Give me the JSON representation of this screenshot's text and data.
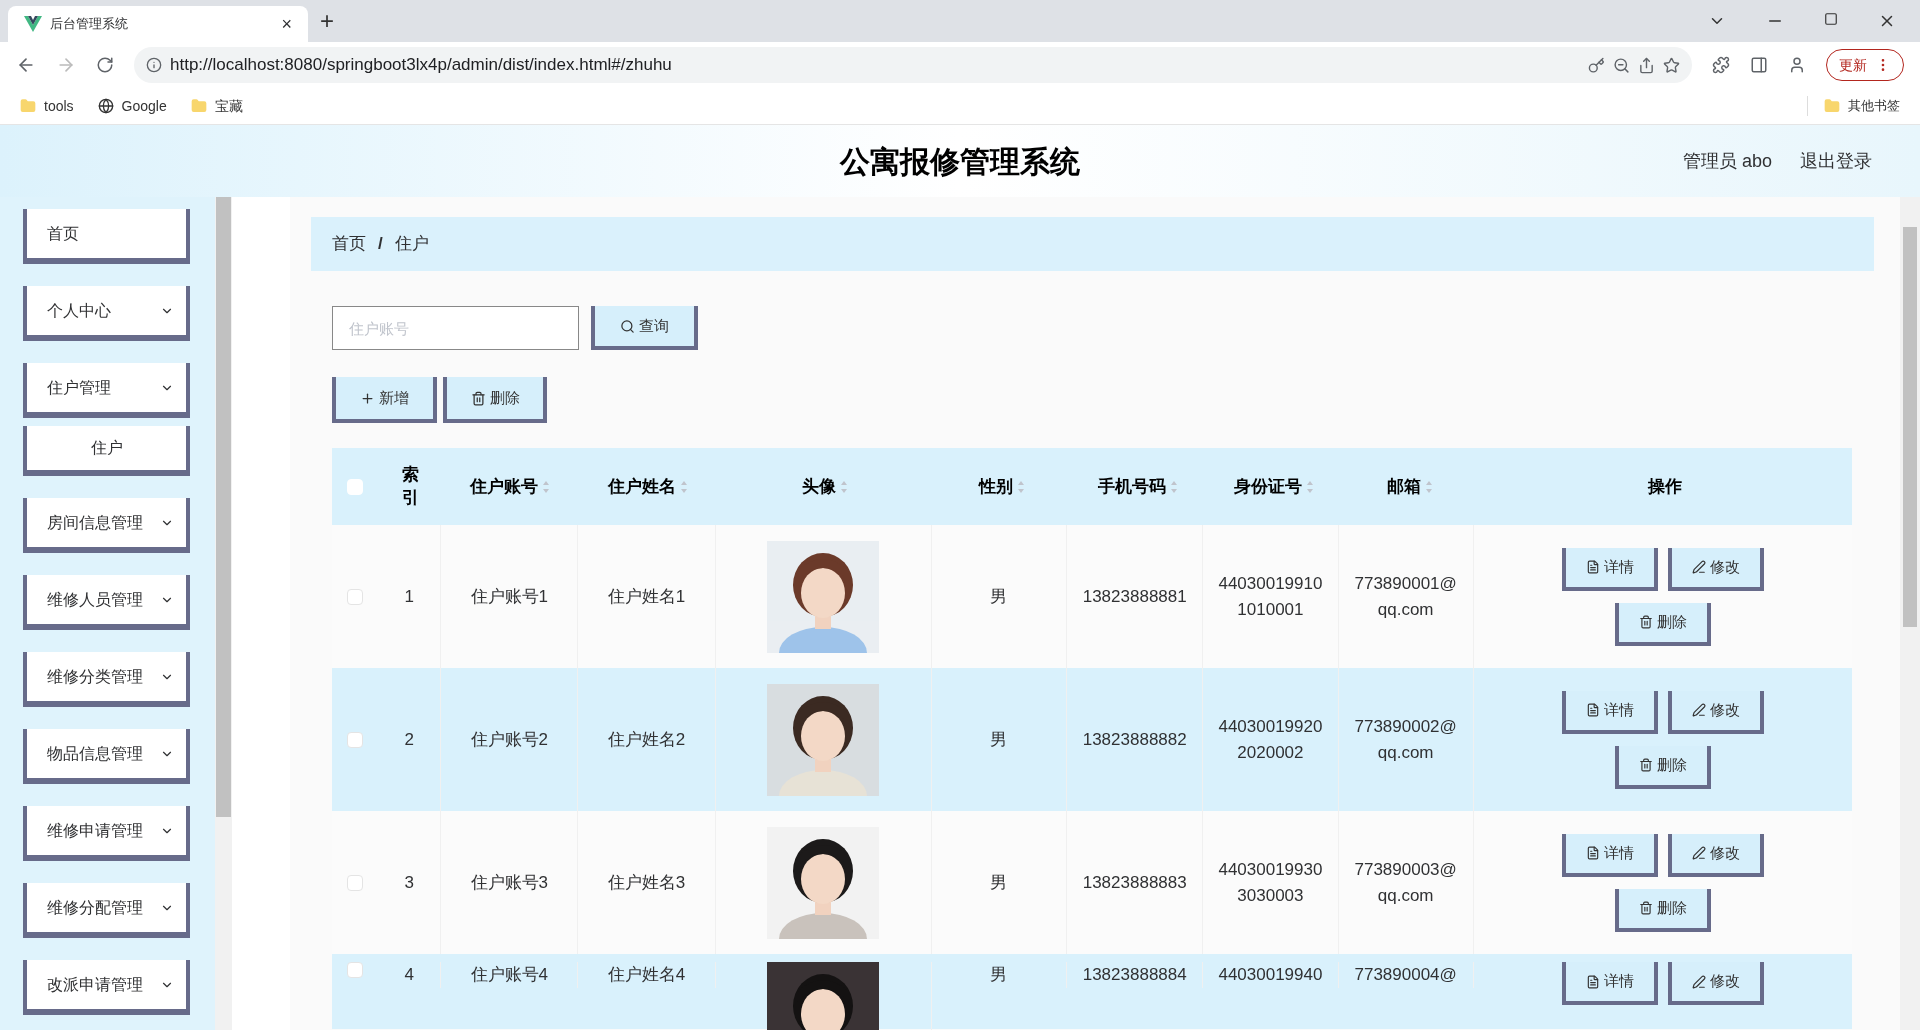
{
  "browser": {
    "tab_title": "后台管理系统",
    "tab_close": "×",
    "new_tab": "+",
    "url": "http://localhost:8080/springboot3lx4p/admin/dist/index.html#/zhuhu",
    "update_button": "更新",
    "bookmarks": [
      {
        "label": "tools",
        "kind": "folder"
      },
      {
        "label": "Google",
        "kind": "site"
      },
      {
        "label": "宝藏",
        "kind": "folder"
      }
    ],
    "other_bookmarks": "其他书签"
  },
  "header": {
    "title": "公寓报修管理系统",
    "user": "管理员 abo",
    "logout": "退出登录"
  },
  "sidebar": {
    "items": [
      {
        "label": "首页",
        "kind": "link"
      },
      {
        "label": "个人中心",
        "kind": "group"
      },
      {
        "label": "住户管理",
        "kind": "group",
        "children": [
          {
            "label": "住户"
          }
        ]
      },
      {
        "label": "房间信息管理",
        "kind": "group"
      },
      {
        "label": "维修人员管理",
        "kind": "group"
      },
      {
        "label": "维修分类管理",
        "kind": "group"
      },
      {
        "label": "物品信息管理",
        "kind": "group"
      },
      {
        "label": "维修申请管理",
        "kind": "group"
      },
      {
        "label": "维修分配管理",
        "kind": "group"
      },
      {
        "label": "改派申请管理",
        "kind": "group"
      }
    ]
  },
  "breadcrumb": [
    "首页",
    "住户"
  ],
  "breadcrumb_separator": "/",
  "search": {
    "placeholder": "住户账号",
    "button": "查询"
  },
  "toolbar": {
    "add": "新增",
    "delete": "删除"
  },
  "table": {
    "select_all": {
      "checked": false
    },
    "columns": [
      {
        "label": "索引",
        "sortable": false
      },
      {
        "label": "住户账号",
        "sortable": true
      },
      {
        "label": "住户姓名",
        "sortable": true
      },
      {
        "label": "头像",
        "sortable": true
      },
      {
        "label": "性别",
        "sortable": true
      },
      {
        "label": "手机号码",
        "sortable": true
      },
      {
        "label": "身份证号",
        "sortable": true
      },
      {
        "label": "邮箱",
        "sortable": true
      },
      {
        "label": "操作",
        "sortable": false
      }
    ],
    "rows": [
      {
        "checked": false,
        "index": "1",
        "account": "住户账号1",
        "name": "住户姓名1",
        "avatar": {
          "kind": "picture"
        },
        "gender": "男",
        "phone": "13823888881",
        "id_number": [
          "44030019910",
          "1010001"
        ],
        "email": [
          "773890001@",
          "qq.com"
        ],
        "actions": [
          "详情",
          "修改",
          "删除"
        ]
      },
      {
        "checked": false,
        "index": "2",
        "account": "住户账号2",
        "name": "住户姓名2",
        "avatar": {
          "kind": "picture"
        },
        "gender": "男",
        "phone": "13823888882",
        "id_number": [
          "44030019920",
          "2020002"
        ],
        "email": [
          "773890002@",
          "qq.com"
        ],
        "actions": [
          "详情",
          "修改",
          "删除"
        ]
      },
      {
        "checked": false,
        "index": "3",
        "account": "住户账号3",
        "name": "住户姓名3",
        "avatar": {
          "kind": "picture"
        },
        "gender": "男",
        "phone": "13823888883",
        "id_number": [
          "44030019930",
          "3030003"
        ],
        "email": [
          "773890003@",
          "qq.com"
        ],
        "actions": [
          "详情",
          "修改",
          "删除"
        ]
      },
      {
        "checked": false,
        "index": "4",
        "account": "住户账号4",
        "name": "住户姓名4",
        "avatar": {
          "kind": "picture"
        },
        "gender": "男",
        "phone": "13823888884",
        "id_number": [
          "44030019940"
        ],
        "email": [
          "773890004@"
        ],
        "actions": [
          "详情",
          "修改"
        ]
      }
    ]
  }
}
